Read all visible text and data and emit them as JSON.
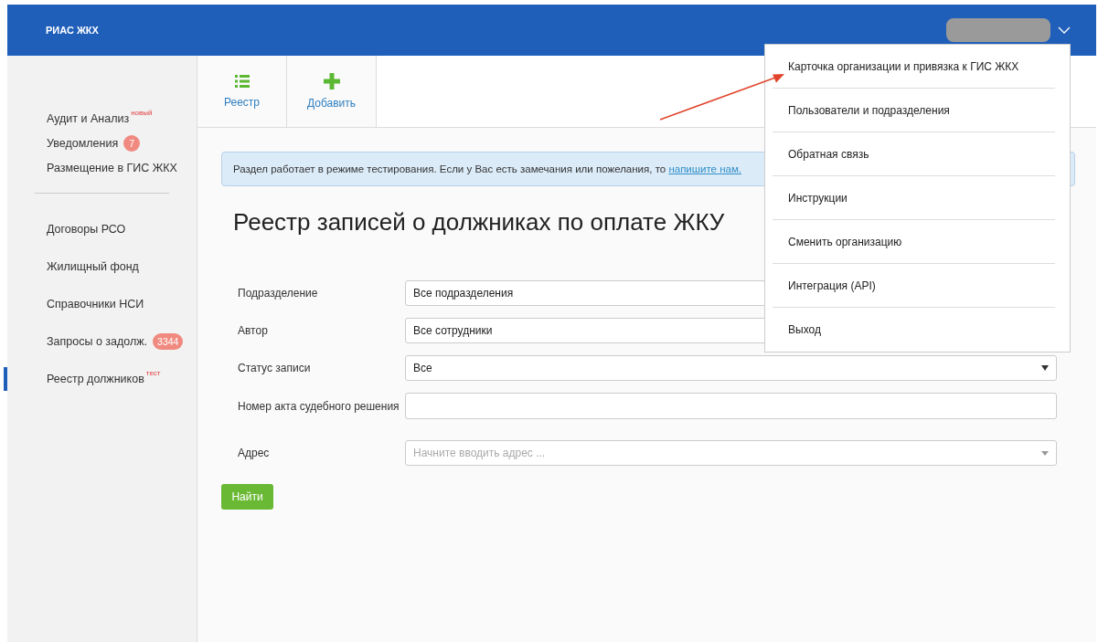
{
  "header": {
    "title": "РИАС ЖКХ"
  },
  "sidebar": {
    "groups": [
      [
        {
          "label": "Аудит и Анализ",
          "tag": "новый",
          "selected": false
        },
        {
          "label": "Уведомления",
          "count": "7",
          "selected": false
        },
        {
          "label": "Размещение в ГИС ЖКХ",
          "selected": false
        }
      ],
      [
        {
          "label": "Договоры РСО",
          "selected": false
        },
        {
          "label": "Жилищный фонд",
          "selected": false
        },
        {
          "label": "Справочники НСИ",
          "selected": false
        },
        {
          "label": "Запросы о задолж.",
          "count": "3344",
          "selected": false
        },
        {
          "label": "Реестр должников",
          "tag": "тест",
          "selected": true
        }
      ]
    ]
  },
  "toolbar": [
    {
      "label": "Реестр",
      "kind": "list"
    },
    {
      "label": "Добавить",
      "kind": "add"
    }
  ],
  "notice": {
    "text": "Раздел работает в режиме тестирования. Если у Вас есть замечания или пожелания, то ",
    "link": "напишите нам."
  },
  "title": "Реестр записей о должниках по оплате ЖКУ",
  "filters": [
    {
      "label": "Подразделение",
      "kind": "select",
      "value": "Все подразделения"
    },
    {
      "label": "Автор",
      "kind": "select",
      "value": "Все сотрудники"
    },
    {
      "label": "Статус записи",
      "kind": "select",
      "value": "Все",
      "caret": true
    },
    {
      "label": "Номер акта судебного решения",
      "kind": "text"
    },
    {
      "label": "Адрес",
      "kind": "autocomplete",
      "placeholder": "Начните вводить адрес ...",
      "caret": true
    }
  ],
  "search_button": "Найти",
  "user_menu": {
    "items": [
      "Карточка организации и привязка к ГИС ЖКХ",
      "Пользователи и подразделения",
      "Обратная связь",
      "Инструкции",
      "Сменить организацию",
      "Интеграция (API)",
      "Выход"
    ]
  }
}
